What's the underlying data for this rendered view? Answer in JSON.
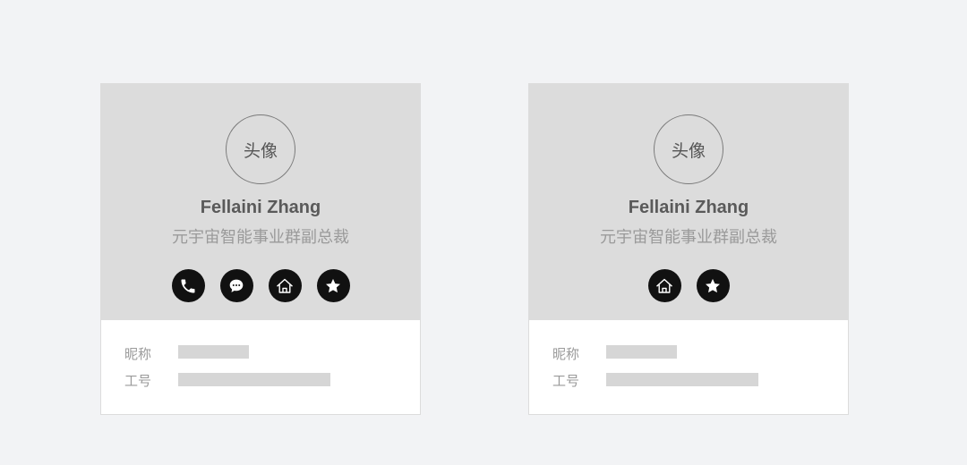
{
  "cards": [
    {
      "avatar_text": "头像",
      "name": "Fellaini Zhang",
      "title": "元宇宙智能事业群副总裁",
      "actions": [
        "phone-icon",
        "chat-icon",
        "home-icon",
        "star-icon"
      ],
      "fields": [
        {
          "label": "昵称"
        },
        {
          "label": "工号"
        }
      ]
    },
    {
      "avatar_text": "头像",
      "name": "Fellaini Zhang",
      "title": "元宇宙智能事业群副总裁",
      "actions": [
        "home-icon",
        "star-icon"
      ],
      "fields": [
        {
          "label": "昵称"
        },
        {
          "label": "工号"
        }
      ]
    }
  ],
  "colors": {
    "background": "#f2f3f5",
    "card_top": "#dcdcdc",
    "icon_button": "#111111",
    "placeholder_bar": "#d6d6d6"
  }
}
